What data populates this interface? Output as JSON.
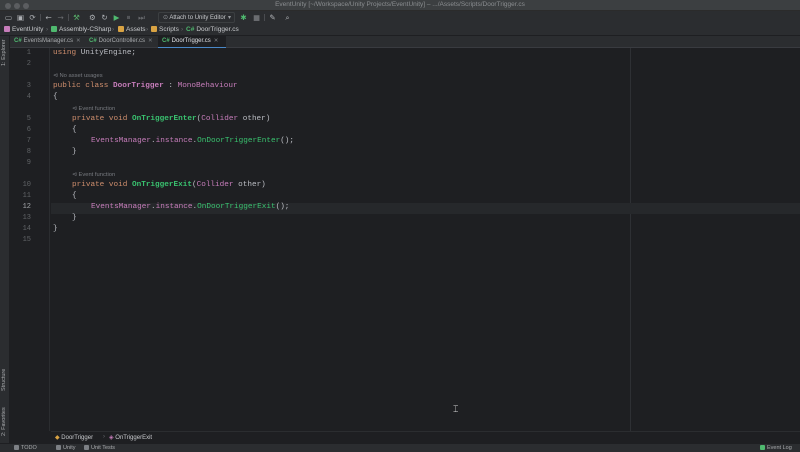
{
  "window": {
    "title": "EventUnity [~/Workspace/Unity Projects/EventUnity] – .../Assets/Scripts/DoorTrigger.cs"
  },
  "toolbar": {
    "run_config": "Attach to Unity Editor"
  },
  "breadcrumbs": [
    "EventUnity",
    "Assembly-CSharp",
    "Assets",
    "Scripts",
    "DoorTrigger.cs"
  ],
  "tabs": [
    {
      "label": "EventsManager.cs",
      "active": false
    },
    {
      "label": "DoorController.cs",
      "active": false
    },
    {
      "label": "DoorTrigger.cs",
      "active": true
    }
  ],
  "left_tool_windows": [
    "1: Explorer",
    "Structure",
    "2: Favorites"
  ],
  "editor": {
    "line_numbers": [
      "1",
      "2",
      "3",
      "4",
      "5",
      "6",
      "7",
      "8",
      "9",
      "10",
      "11",
      "12",
      "13",
      "14",
      "15"
    ],
    "current_line": "12",
    "hints": {
      "class_usages": "No asset usages",
      "method1": "Event function",
      "method2": "Event function"
    },
    "code": {
      "l1_kw": "using",
      "l1_rest": " UnityEngine;",
      "l3_kw": "public class ",
      "l3_name": "DoorTrigger",
      "l3_colon": " : ",
      "l3_base": "MonoBehaviour",
      "l4": "{",
      "l5_kw": "private void ",
      "l5_name": "OnTriggerEnter",
      "l5_open": "(",
      "l5_type": "Collider",
      "l5_rest": " other)",
      "l6": "{",
      "l7_cls": "EventsManager",
      "l7_dot": ".",
      "l7_member": "instance",
      "l7_dot2": ".",
      "l7_call": "OnDoorTriggerEnter",
      "l7_end": "();",
      "l8": "}",
      "l10_kw": "private void ",
      "l10_name": "OnTriggerExit",
      "l10_open": "(",
      "l10_type": "Collider",
      "l10_rest": " other)",
      "l11": "{",
      "l12_cls": "EventsManager",
      "l12_dot": ".",
      "l12_member": "instance",
      "l12_dot2": ".",
      "l12_call": "OnDoorTriggerExit",
      "l12_end": "();",
      "l13": "}",
      "l14": "}"
    }
  },
  "bottom_breadcrumb": [
    "DoorTrigger",
    "OnTriggerExit"
  ],
  "statusbar": {
    "todo": "TODO",
    "unity": "Unity",
    "unit_tests": "Unit Tests",
    "event_log": "Event Log"
  },
  "colors": {
    "accent": "#4a88c7",
    "csharp_badge": "#4fb96f",
    "keyword": "#cf8e6d",
    "method": "#39c26f"
  }
}
